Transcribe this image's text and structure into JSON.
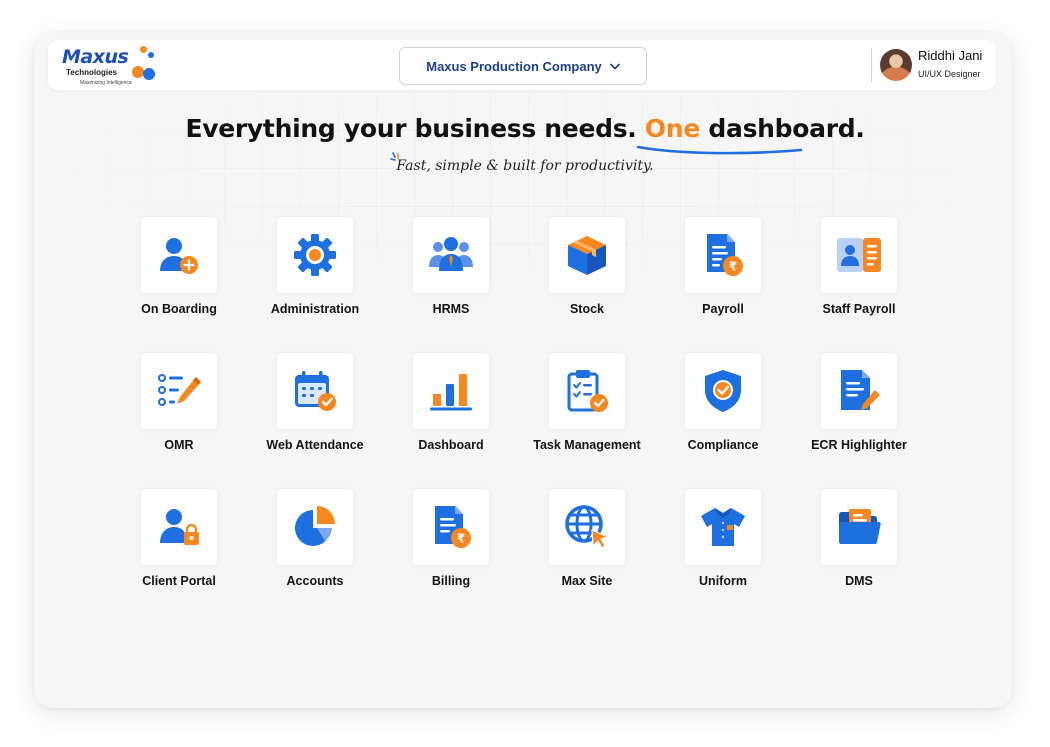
{
  "brand": {
    "name": "Maxus",
    "sub": "Technologies",
    "tagline": "Maximizing Intelligence",
    "colors": {
      "blue": "#1e6fe0",
      "orange": "#f7871f"
    }
  },
  "header": {
    "company": "Maxus Production Company",
    "user": {
      "name": "Riddhi Jani",
      "role": "UI/UX Designer"
    }
  },
  "hero": {
    "headline_pre": "Everything your business needs. ",
    "headline_accent": "One",
    "headline_post": " dashboard.",
    "subhead": "Fast, simple & built for productivity."
  },
  "apps": [
    {
      "label": "On Boarding",
      "icon": "user-add-icon"
    },
    {
      "label": "Administration",
      "icon": "gear-icon"
    },
    {
      "label": "HRMS",
      "icon": "team-icon"
    },
    {
      "label": "Stock",
      "icon": "box-icon"
    },
    {
      "label": "Payroll",
      "icon": "payroll-document-icon"
    },
    {
      "label": "Staff Payroll",
      "icon": "id-card-icon"
    },
    {
      "label": "OMR",
      "icon": "checklist-pencil-icon"
    },
    {
      "label": "Web Attendance",
      "icon": "calendar-check-icon"
    },
    {
      "label": "Dashboard",
      "icon": "bar-chart-icon"
    },
    {
      "label": "Task Management",
      "icon": "clipboard-check-icon"
    },
    {
      "label": "Compliance",
      "icon": "shield-check-icon"
    },
    {
      "label": "ECR Highlighter",
      "icon": "document-edit-icon"
    },
    {
      "label": "Client Portal",
      "icon": "user-lock-icon"
    },
    {
      "label": "Accounts",
      "icon": "pie-chart-icon"
    },
    {
      "label": "Billing",
      "icon": "bill-document-icon"
    },
    {
      "label": "Max Site",
      "icon": "globe-cursor-icon"
    },
    {
      "label": "Uniform",
      "icon": "shirt-icon"
    },
    {
      "label": "DMS",
      "icon": "folder-icon"
    }
  ]
}
